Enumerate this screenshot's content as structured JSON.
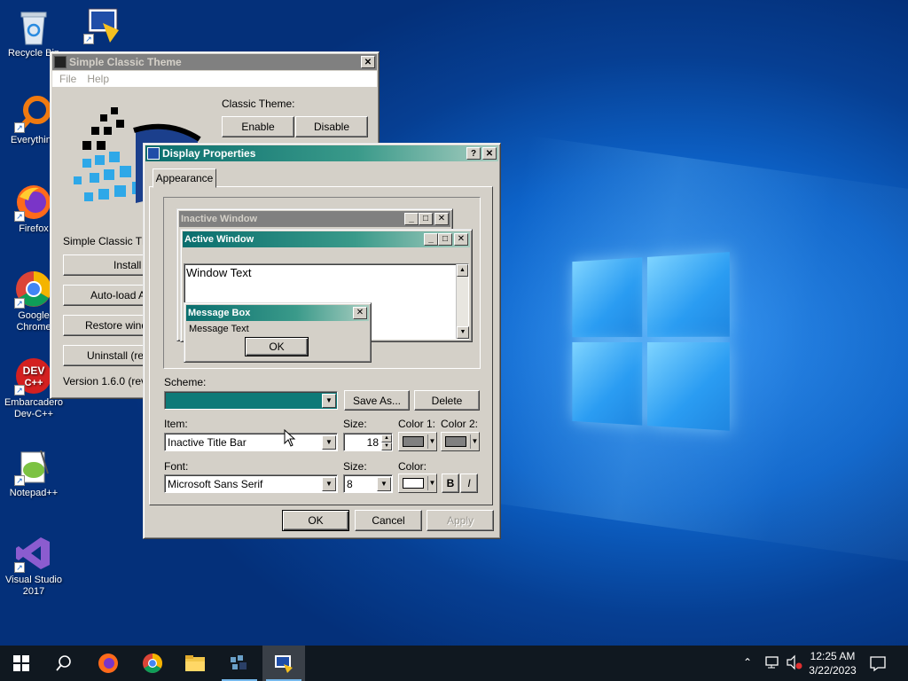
{
  "desktop": {
    "icons": [
      {
        "label": "Recycle Bin"
      },
      {
        "label": ""
      },
      {
        "label": "Everything"
      },
      {
        "label": "Firefox"
      },
      {
        "label": "Google Chrome"
      },
      {
        "label": "Embarcadero Dev-C++"
      },
      {
        "label": "Notepad++"
      },
      {
        "label": "Visual Studio 2017"
      }
    ]
  },
  "sct": {
    "title": "Simple Classic Theme",
    "menu": [
      "File",
      "Help"
    ],
    "classic_theme_label": "Classic Theme:",
    "enable": "Enable",
    "disable": "Disable",
    "section_label": "Simple Classic Theme",
    "buttons": [
      "Install SCT",
      "Auto-load AHK",
      "Restore window",
      "Uninstall (restore)"
    ],
    "version": "Version 1.6.0 (revision)"
  },
  "display": {
    "title": "Display Properties",
    "help_btn": "?",
    "close_btn": "✕",
    "tab": "Appearance",
    "preview": {
      "inactive_title": "Inactive Window",
      "active_title": "Active Window",
      "window_text": "Window Text",
      "msgbox_title": "Message Box",
      "message_text": "Message Text",
      "ok": "OK"
    },
    "scheme_label": "Scheme:",
    "scheme_value": "",
    "save_as": "Save As...",
    "delete": "Delete",
    "item_label": "Item:",
    "item_value": "Inactive Title Bar",
    "size_label": "Size:",
    "size_value": "18",
    "color1_label": "Color 1:",
    "color2_label": "Color 2:",
    "color1": "#808080",
    "color2": "#808080",
    "font_label": "Font:",
    "font_value": "Microsoft Sans Serif",
    "font_size_label": "Size:",
    "font_size_value": "8",
    "font_color_label": "Color:",
    "font_color": "#ffffff",
    "bold": "B",
    "italic": "I",
    "ok": "OK",
    "cancel": "Cancel",
    "apply": "Apply"
  },
  "taskbar": {
    "time": "12:25 AM",
    "date": "3/22/2023",
    "accent": "#76b9ed"
  }
}
